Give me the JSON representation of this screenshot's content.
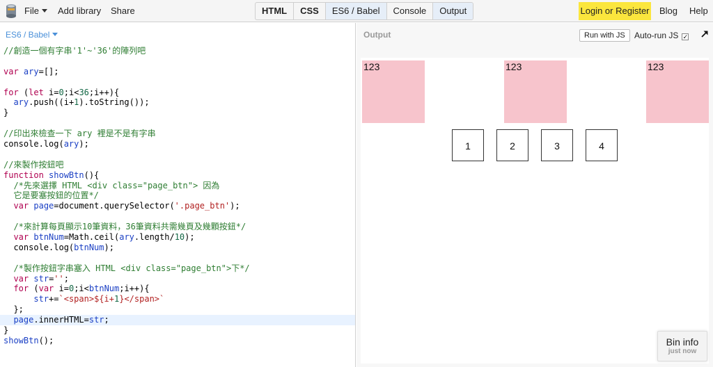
{
  "colors": {
    "accent_yellow": "#fbe63d",
    "active_tab": "#e6eef8",
    "pink_box": "#f7c4cc",
    "link_blue": "#4a90d9"
  },
  "toolbar": {
    "file_label": "File",
    "add_library_label": "Add library",
    "share_label": "Share",
    "tabs": [
      {
        "label": "HTML",
        "active": false
      },
      {
        "label": "CSS",
        "active": false
      },
      {
        "label": "ES6 / Babel",
        "active": true
      },
      {
        "label": "Console",
        "active": false
      },
      {
        "label": "Output",
        "active": true
      }
    ],
    "login_label": "Login or Register",
    "blog_label": "Blog",
    "help_label": "Help"
  },
  "editor": {
    "language_label": "ES6 / Babel",
    "lines": [
      {
        "text": "//創造一個有字串'1'~'36'的陣列吧"
      },
      {
        "text": ""
      },
      {
        "text": "var ary=[];"
      },
      {
        "text": ""
      },
      {
        "text": "for (let i=0;i<36;i++){"
      },
      {
        "text": "  ary.push((i+1).toString());"
      },
      {
        "text": "}"
      },
      {
        "text": ""
      },
      {
        "text": "//印出來檢查一下 ary 裡是不是有字串"
      },
      {
        "text": "console.log(ary);"
      },
      {
        "text": ""
      },
      {
        "text": "//來製作按鈕吧"
      },
      {
        "text": "function showBtn(){"
      },
      {
        "text": "  /*先來選擇 HTML <div class=\"page_btn\"> 因為"
      },
      {
        "text": "  它是要塞按鈕的位置*/"
      },
      {
        "text": "  var page=document.querySelector('.page_btn');"
      },
      {
        "text": ""
      },
      {
        "text": "  /*來計算每頁顯示10筆資料，36筆資料共需幾頁及幾顆按鈕*/"
      },
      {
        "text": "  var btnNum=Math.ceil(ary.length/10);"
      },
      {
        "text": "  console.log(btnNum);"
      },
      {
        "text": ""
      },
      {
        "text": "  /*製作按鈕字串塞入 HTML <div class=\"page_btn\">下*/"
      },
      {
        "text": "  var str='';"
      },
      {
        "text": "  for (var i=0;i<btnNum;i++){"
      },
      {
        "text": "      str+=`<span>${i+1}</span>`"
      },
      {
        "text": "  };"
      },
      {
        "text": "  page.innerHTML=str;",
        "highlight": true
      },
      {
        "text": "}"
      },
      {
        "text": "showBtn();"
      }
    ]
  },
  "output": {
    "label": "Output",
    "run_label": "Run with JS",
    "autorun_label": "Auto-run JS",
    "autorun_checked": true,
    "boxes": [
      "123",
      "123",
      "123"
    ],
    "page_buttons": [
      "1",
      "2",
      "3",
      "4"
    ]
  },
  "bininfo": {
    "title": "Bin info",
    "subtitle": "just now"
  }
}
